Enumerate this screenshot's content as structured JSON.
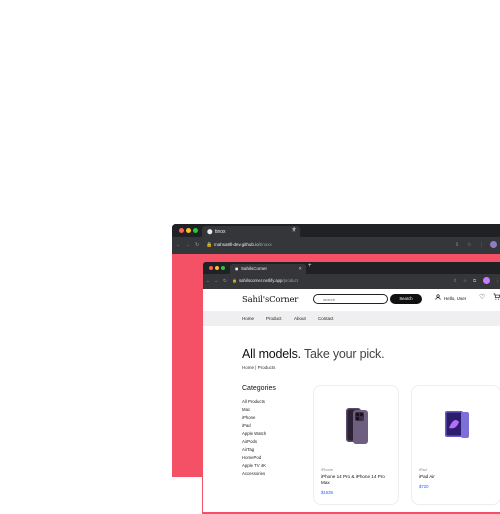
{
  "outer_browser": {
    "tab_title": "tinox",
    "url_domain": "mahsa8ll-dev.github.io",
    "url_path": "/tinoxx"
  },
  "inner_browser": {
    "tab_title": "SahilsCorner",
    "url_domain": "sahilscorner.netlify.app",
    "url_path": "/product"
  },
  "site": {
    "logo": "Sahil'sCorner",
    "search_placeholder": "search",
    "search_button": "Search",
    "user_label": "Hello, User",
    "nav": [
      "Home",
      "Product",
      "About",
      "Contact"
    ],
    "headline_bold": "All models.",
    "headline_rest": "Take your pick.",
    "breadcrumb": "Home | Products",
    "categories_title": "Categories",
    "categories": [
      "All Products",
      "Mac",
      "iPhone",
      "iPad",
      "Apple Watch",
      "AirPods",
      "AirTag",
      "HomePod",
      "Apple TV 4K",
      "Accessories"
    ],
    "products": [
      {
        "category": "iPhone",
        "name": "iPhone 14 Pro & iPhone 14 Pro Max",
        "price": "$1539"
      },
      {
        "category": "iPad",
        "name": "iPad Air",
        "price": "$720"
      }
    ]
  },
  "colors": {
    "outer_page_bg": "#f45066",
    "price_blue": "#2962ff",
    "dot_red": "#ff5f57",
    "dot_yellow": "#febc2e",
    "dot_green": "#28c840"
  },
  "icons": [
    "back-icon",
    "forward-icon",
    "reload-icon",
    "lock-icon",
    "user-icon",
    "heart-icon",
    "cart-icon"
  ]
}
